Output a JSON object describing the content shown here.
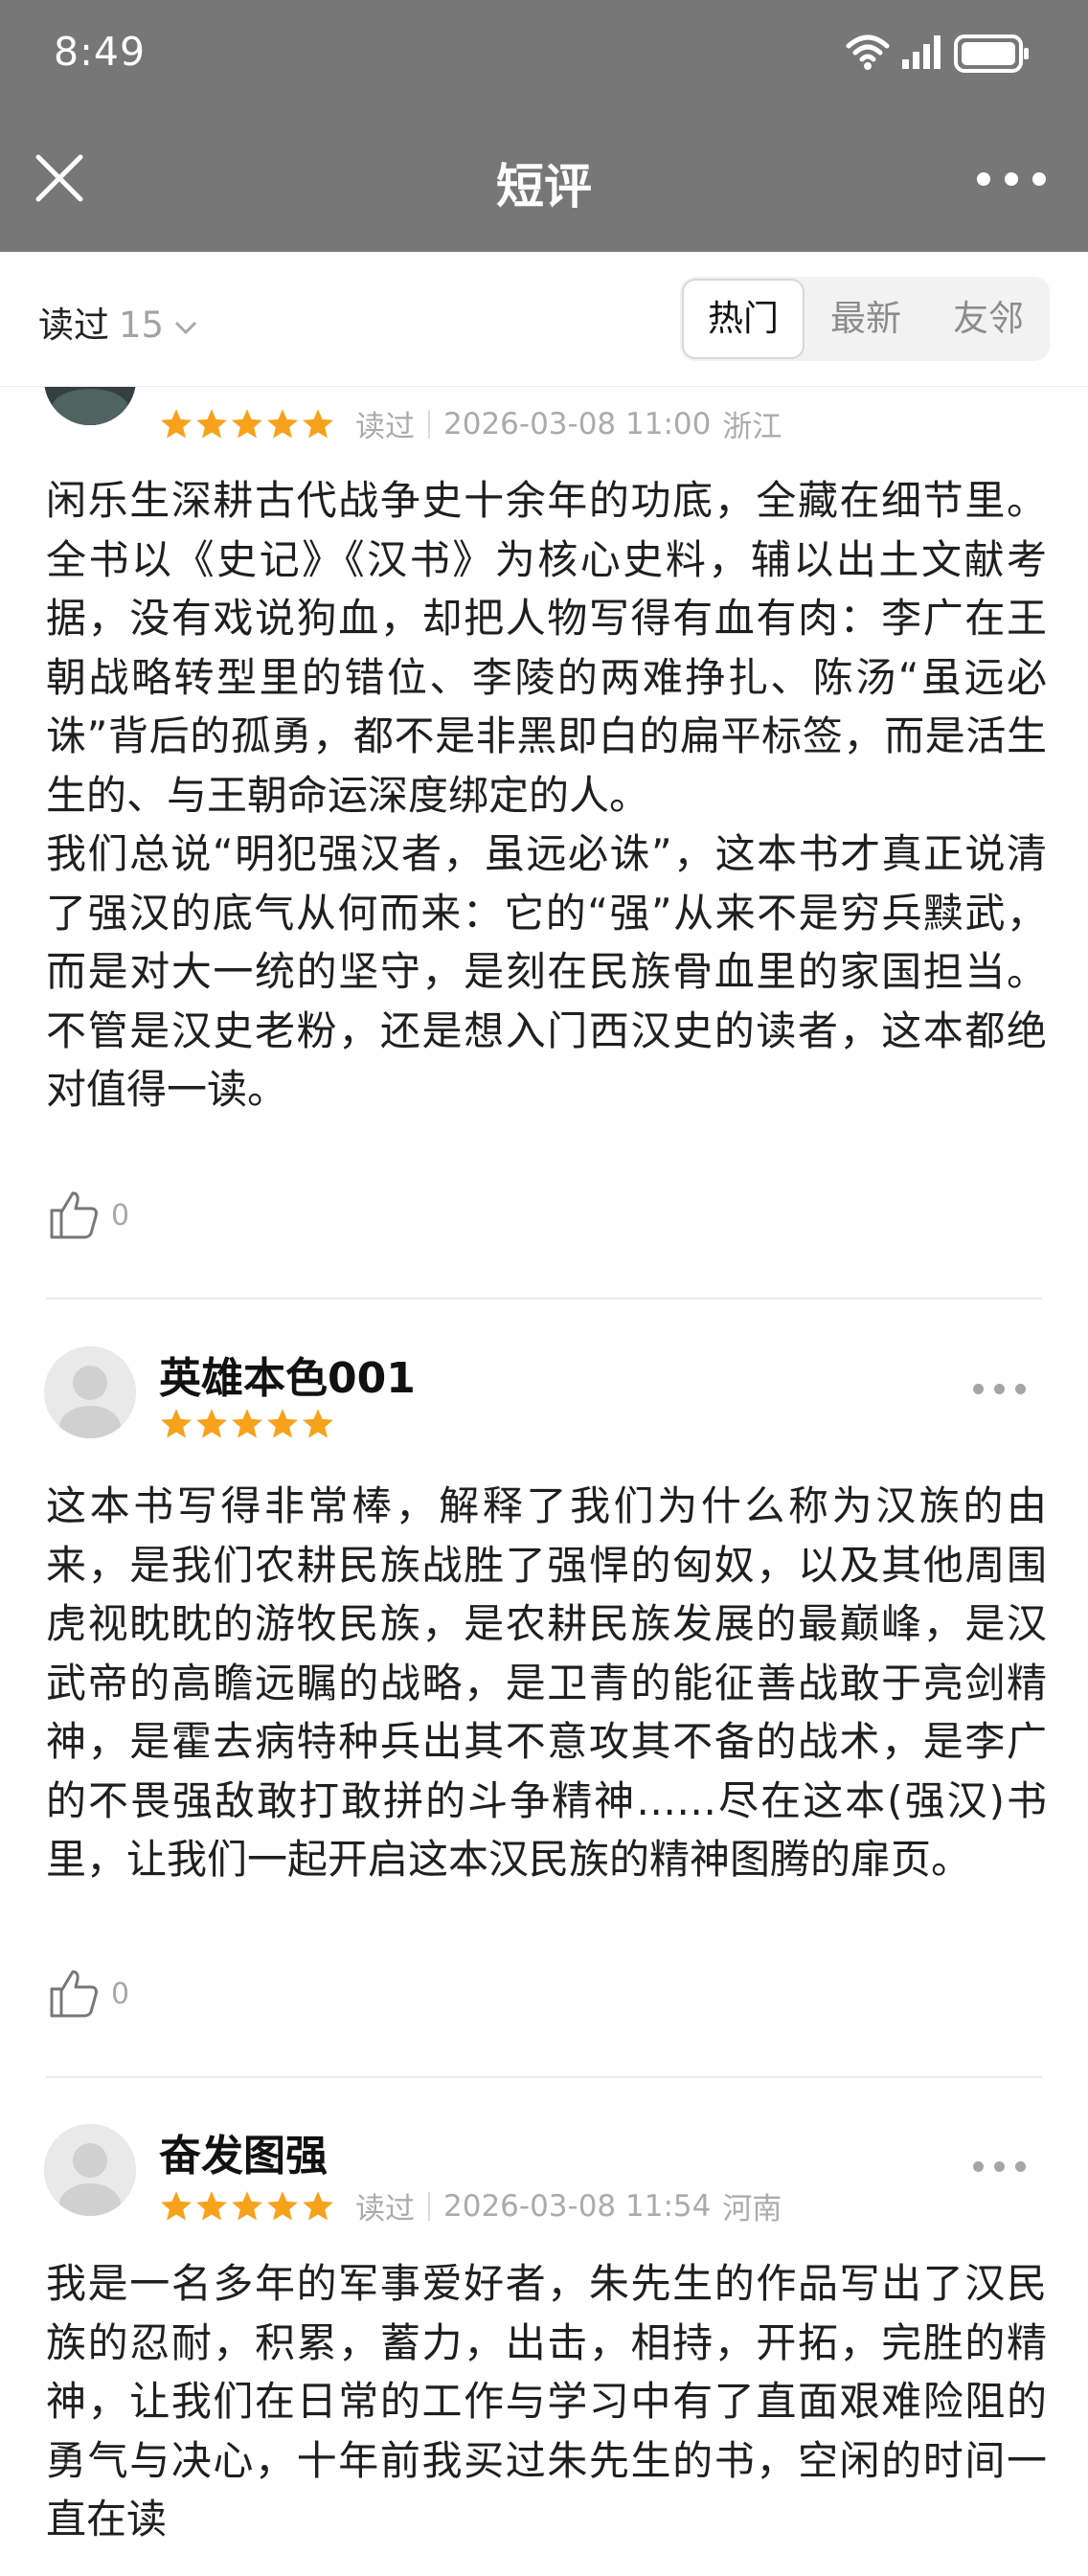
{
  "status_bar": {
    "time": "8:49"
  },
  "header": {
    "title": "短评"
  },
  "filter": {
    "read_label": "读过",
    "read_count": "15",
    "tabs": [
      {
        "label": "热门",
        "active": true
      },
      {
        "label": "最新",
        "active": false
      },
      {
        "label": "友邻",
        "active": false
      }
    ]
  },
  "colors": {
    "header_bg": "#777777",
    "star": "#f7a21b",
    "muted": "#ababab"
  },
  "reviews": [
    {
      "username": "",
      "rating": 5,
      "status": "读过",
      "time": "2026-03-08 11:00",
      "location": "浙江",
      "text": "闲乐生深耕古代战争史十余年的功底，全藏在细节里。全书以《史记》《汉书》为核心史料，辅以出土文献考据，没有戏说狗血，却把人物写得有血有肉：李广在王朝战略转型里的错位、李陵的两难挣扎、陈汤“虽远必诛”背后的孤勇，都不是非黑即白的扁平标签，而是活生生的、与王朝命运深度绑定的人。\n我们总说“明犯强汉者，虽远必诛”，这本书才真正说清了强汉的底气从何而来：它的“强”从来不是穷兵黩武，而是对大一统的坚守，是刻在民族骨血里的家国担当。不管是汉史老粉，还是想入门西汉史的读者，这本都绝对值得一读。",
      "likes": "0"
    },
    {
      "username": "英雄本色001",
      "rating": 5,
      "status": "",
      "time": "",
      "location": "",
      "text": "这本书写得非常棒，解释了我们为什么称为汉族的由来，是我们农耕民族战胜了强悍的匈奴，以及其他周围虎视眈眈的游牧民族，是农耕民族发展的最巅峰，是汉武帝的高瞻远瞩的战略，是卫青的能征善战敢于亮剑精神，是霍去病特种兵出其不意攻其不备的战术，是李广的不畏强敌敢打敢拼的斗争精神……尽在这本(强汉)书里，让我们一起开启这本汉民族的精神图腾的扉页。",
      "likes": "0"
    },
    {
      "username": "奋发图强",
      "rating": 5,
      "status": "读过",
      "time": "2026-03-08 11:54",
      "location": "河南",
      "text": "我是一名多年的军事爱好者，朱先生的作品写出了汉民族的忍耐，积累，蓄力，出击，相持，开拓，完胜的精神，让我们在日常的工作与学习中有了直面艰难险阻的勇气与决心，十年前我买过朱先生的书，空闲的时间一直在读",
      "likes": ""
    }
  ]
}
